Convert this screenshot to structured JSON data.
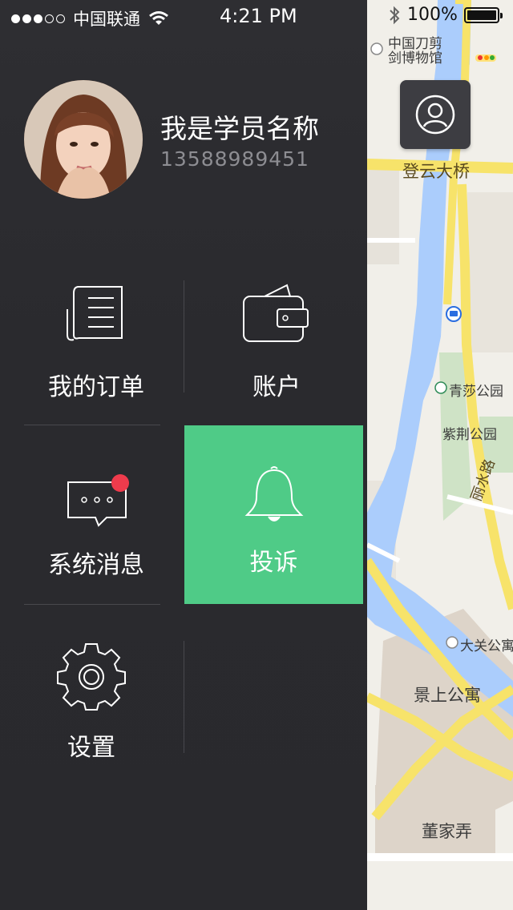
{
  "status_bar": {
    "carrier": "中国联通",
    "time": "4:21 PM",
    "battery": "100%",
    "signal_dots": [
      true,
      true,
      true,
      false,
      false
    ]
  },
  "profile": {
    "name": "我是学员名称",
    "phone": "13588989451"
  },
  "menu": {
    "orders": "我的订单",
    "account": "账户",
    "messages": "系统消息",
    "complaint": "投诉",
    "settings": "设置"
  },
  "map": {
    "labels": {
      "museum_line1": "中国刀剪",
      "museum_line2": "剑博物馆",
      "bridge": "登云大桥",
      "park1": "青莎公园",
      "park2": "紫荆公园",
      "road": "丽水路",
      "apartment1": "大关公寓",
      "apartment2": "景上公寓",
      "lane": "董家弄"
    }
  },
  "colors": {
    "drawer_bg": "#2b2b2f",
    "accent_green": "#4fcb87",
    "badge_red": "#ef3b4c",
    "water": "#abcdfc",
    "road": "#f7e36a"
  }
}
